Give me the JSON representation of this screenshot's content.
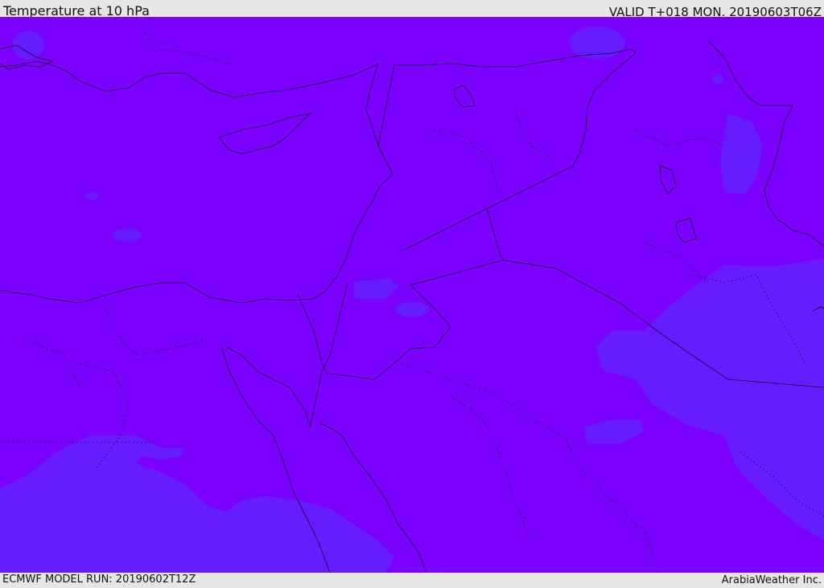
{
  "header": {
    "title": "Temperature at 10 hPa",
    "valid_time": "VALID T+018 MON. 20190603T06Z"
  },
  "footer": {
    "model_run": "ECMWF MODEL RUN: 20190602T12Z",
    "credit": "ArabiaWeather Inc."
  },
  "map": {
    "field_colors": {
      "dominant": "#7b00ff",
      "secondary": "#661cff"
    },
    "border_color": "#1a0033"
  }
}
